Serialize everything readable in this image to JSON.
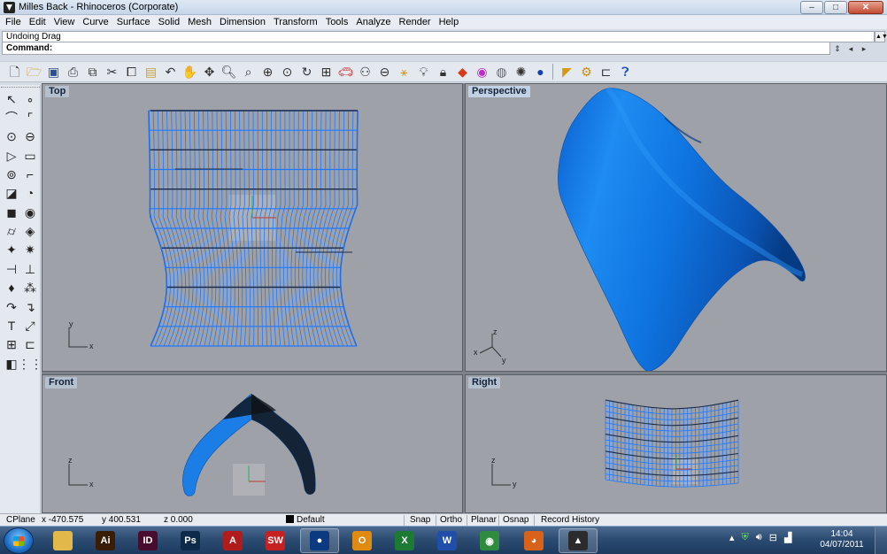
{
  "window": {
    "title": "Milles Back - Rhinoceros (Corporate)",
    "controls": {
      "minimize": "–",
      "maximize": "□",
      "close": "✕"
    }
  },
  "menu": [
    "File",
    "Edit",
    "View",
    "Curve",
    "Surface",
    "Solid",
    "Mesh",
    "Dimension",
    "Transform",
    "Tools",
    "Analyze",
    "Render",
    "Help"
  ],
  "command": {
    "history": "Undoing Drag",
    "prompt": "Command:"
  },
  "toolbar": {
    "icons": [
      "new-icon",
      "open-icon",
      "save-icon",
      "print-icon",
      "import-icon",
      "cut-icon",
      "copy-icon",
      "paste-icon",
      "undo-icon",
      "pan-icon",
      "rotate-view-icon",
      "zoom-icon",
      "zoom-window-icon",
      "zoom-extents-icon",
      "zoom-selected-icon",
      "rotate-icon",
      "four-views-icon",
      "car-icon",
      "paint-icon",
      "clock-icon",
      "snap-icon",
      "light-icon",
      "lock-icon",
      "layer-icon",
      "color-icon",
      "sphere-icon",
      "render-icon",
      "globe-icon",
      "pointer-icon",
      "gear-icon",
      "dimension-icon",
      "help-icon"
    ]
  },
  "viewports": {
    "top": {
      "label": "Top",
      "axis_y": "y",
      "axis_x": "x"
    },
    "perspective": {
      "label": "Perspective",
      "axis_z": "z",
      "axis_x": "x",
      "axis_y": "y"
    },
    "front": {
      "label": "Front",
      "axis_z": "z",
      "axis_x": "x"
    },
    "right": {
      "label": "Right",
      "axis_z": "z",
      "axis_y": "y"
    }
  },
  "status": {
    "cplane": "CPlane",
    "x": "x -470.575",
    "y": "y 400.531",
    "z": "z 0.000",
    "layer": "Default",
    "snap": "Snap",
    "ortho": "Ortho",
    "planar": "Planar",
    "osnap": "Osnap",
    "record_history": "Record History"
  },
  "taskbar": {
    "apps": [
      {
        "name": "explorer",
        "glyph": "",
        "color": "#e3b84a"
      },
      {
        "name": "illustrator",
        "glyph": "Ai",
        "color": "#3a1d05"
      },
      {
        "name": "indesign",
        "glyph": "ID",
        "color": "#4a0c2e"
      },
      {
        "name": "photoshop",
        "glyph": "Ps",
        "color": "#0d2a4a"
      },
      {
        "name": "acrobat",
        "glyph": "A",
        "color": "#b01c1c"
      },
      {
        "name": "solidworks",
        "glyph": "SW",
        "color": "#c62020"
      },
      {
        "name": "rhino",
        "glyph": "●",
        "color": "#0b3a80"
      },
      {
        "name": "outlook",
        "glyph": "O",
        "color": "#e08a12"
      },
      {
        "name": "excel",
        "glyph": "X",
        "color": "#1d7a35"
      },
      {
        "name": "word",
        "glyph": "W",
        "color": "#1f4fa8"
      },
      {
        "name": "chrome",
        "glyph": "◉",
        "color": "#2f8c3f"
      },
      {
        "name": "firefox",
        "glyph": "◕",
        "color": "#d9621b"
      },
      {
        "name": "rhino-model",
        "glyph": "▲",
        "color": "#2b2b2b"
      }
    ],
    "time": "14:04",
    "date": "04/07/2011"
  },
  "colors": {
    "surface": "#1a7ee6",
    "wire": "#1f78ff",
    "viewport_bg": "#9ea2a8"
  }
}
